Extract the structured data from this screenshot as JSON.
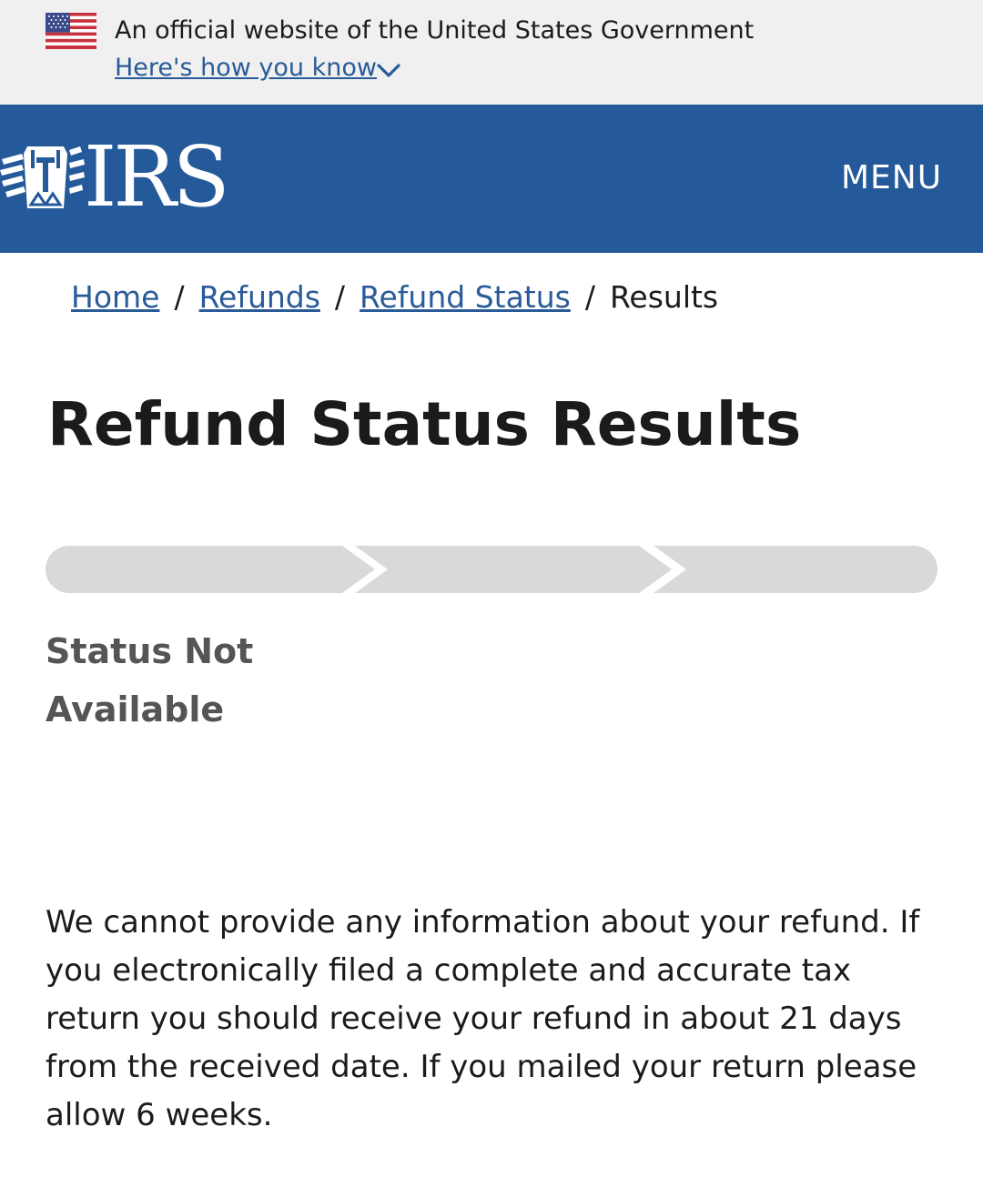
{
  "gov_banner": {
    "official_text": "An official website of the United States Government",
    "how_you_know_label": "Here's how you know",
    "flag_icon": "us-flag-icon",
    "chevron_icon": "chevron-down-icon"
  },
  "header": {
    "logo_text": "IRS",
    "logo_icon": "irs-eagle-icon",
    "menu_label": "MENU",
    "background_color": "#24599a"
  },
  "breadcrumb": {
    "items": [
      {
        "label": "Home"
      },
      {
        "label": "Refunds"
      },
      {
        "label": "Refund Status"
      }
    ],
    "separator": "/",
    "current": "Results"
  },
  "page": {
    "title": "Refund Status Results"
  },
  "progress": {
    "steps_total": 3,
    "steps_completed": 0,
    "inactive_color": "#d9d9db"
  },
  "status": {
    "heading": "Status Not Available",
    "color": "#555555"
  },
  "message": {
    "text": "We cannot provide any information about your refund. If you electronically filed a complete and accurate tax return you should receive your refund in about 21 days from the received date. If you mailed your return please allow 6 weeks."
  },
  "colors": {
    "link": "#2a5b99",
    "banner_bg": "#f0f0f0"
  }
}
